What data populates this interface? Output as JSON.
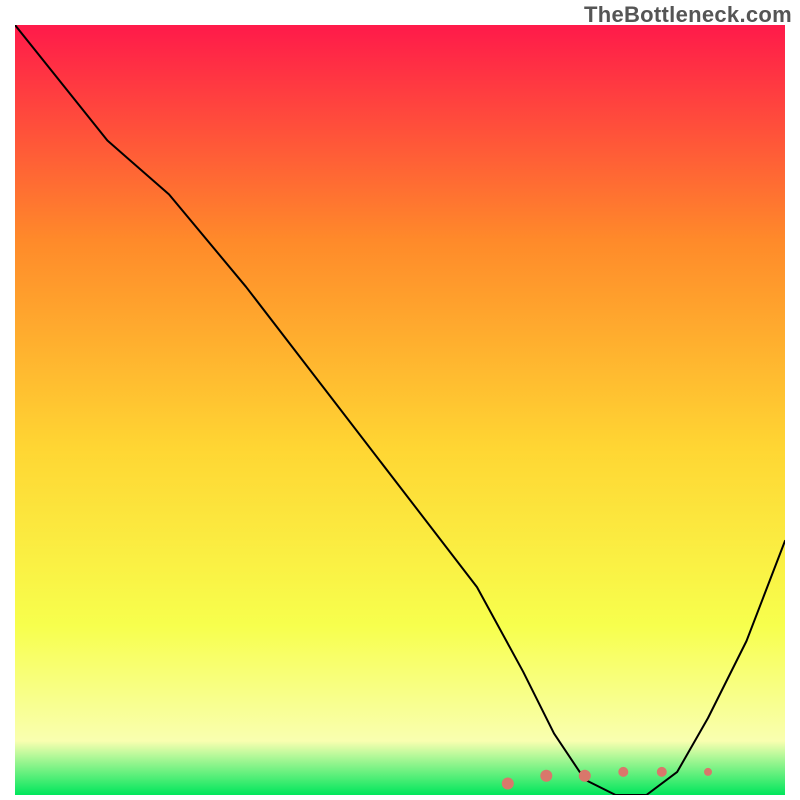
{
  "watermark": "TheBottleneck.com",
  "chart_data": {
    "type": "line",
    "title": "",
    "xlabel": "",
    "ylabel": "",
    "xlim": [
      0,
      100
    ],
    "ylim": [
      0,
      100
    ],
    "background_gradient": {
      "top": "#ff1a4a",
      "upper_mid": "#ff8a2a",
      "mid": "#ffd633",
      "lower_mid": "#f7ff4d",
      "near_bottom": "#f9ffb0",
      "bottom": "#00e65c"
    },
    "series": [
      {
        "name": "bottleneck-curve",
        "color": "#000000",
        "stroke_width": 2,
        "x": [
          0,
          12,
          20,
          30,
          40,
          50,
          60,
          66,
          70,
          74,
          78,
          82,
          86,
          90,
          95,
          100
        ],
        "y_percent": [
          100,
          85,
          78,
          66,
          53,
          40,
          27,
          16,
          8,
          2,
          0,
          0,
          3,
          10,
          20,
          33
        ]
      }
    ],
    "blob": {
      "name": "bottleneck-marker",
      "color": "#d9776b",
      "cx_percent": 74,
      "cy_percent": 1.5,
      "points_rel": [
        {
          "dx": -10,
          "dy": 0,
          "r": 6
        },
        {
          "dx": -5,
          "dy": 1,
          "r": 6
        },
        {
          "dx": 0,
          "dy": 1,
          "r": 6
        },
        {
          "dx": 5,
          "dy": 1.5,
          "r": 5
        },
        {
          "dx": 10,
          "dy": 1.5,
          "r": 5
        },
        {
          "dx": 16,
          "dy": 1.5,
          "r": 4
        }
      ]
    }
  }
}
